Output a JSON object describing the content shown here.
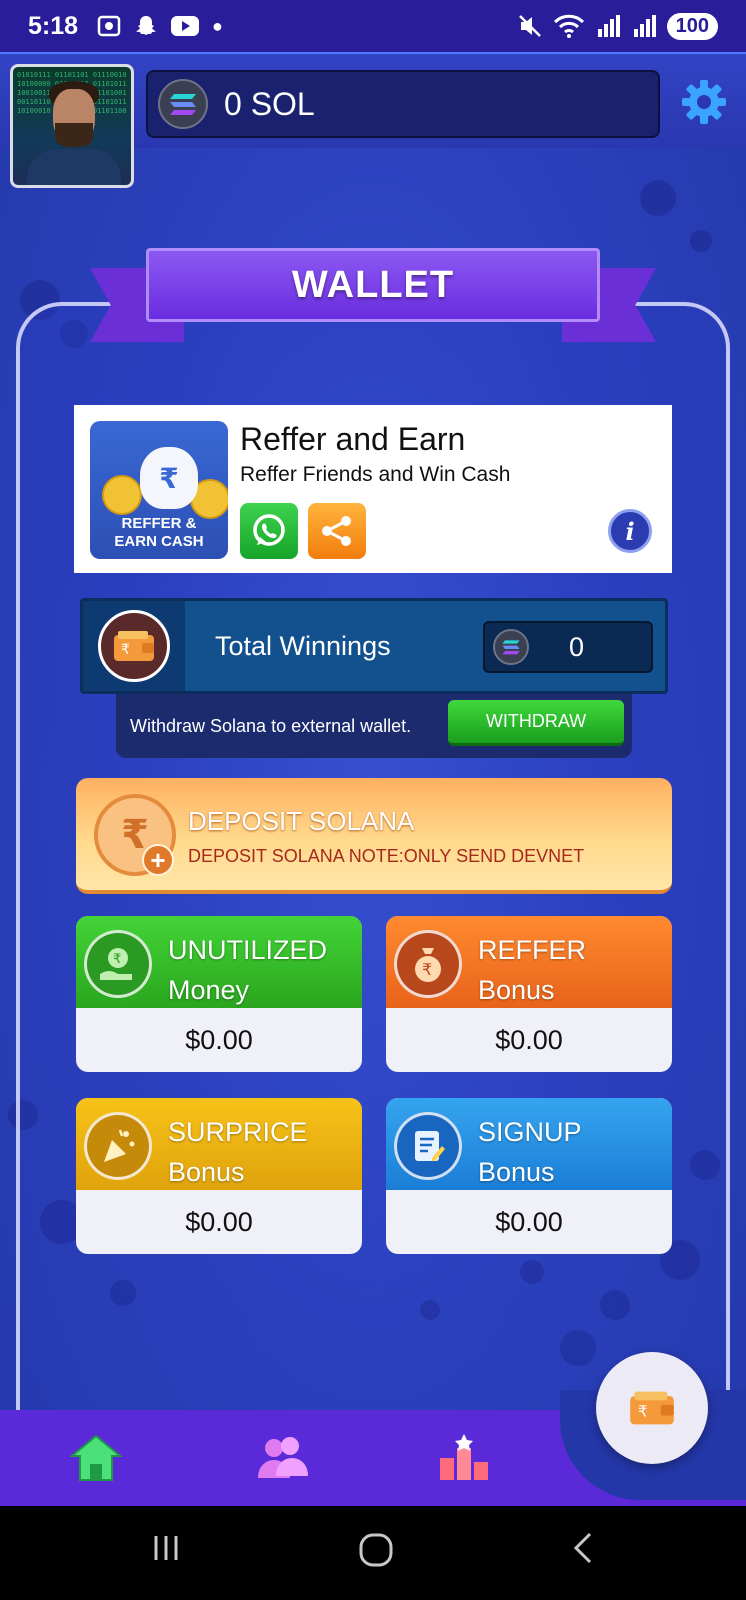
{
  "status_bar": {
    "time": "5:18",
    "battery": "100"
  },
  "header": {
    "balance": "0 SOL",
    "avatar_code": "01010111 01101101 01110010 10100000 01010010 01101011 10010011 10100110 01101001 00110110 01010111 01101011 10100010 01011001 01101100"
  },
  "wallet": {
    "title": "WALLET"
  },
  "refer": {
    "image_label_line1": "REFFER &",
    "image_label_line2": "EARN CASH",
    "title": "Reffer and Earn",
    "subtitle": "Reffer Friends and Win Cash"
  },
  "winnings": {
    "label": "Total Winnings",
    "value": "0",
    "withdraw_text": "Withdraw Solana to external wallet.",
    "withdraw_button": "WITHDRAW"
  },
  "deposit": {
    "title": "DEPOSIT SOLANA",
    "note": "DEPOSIT SOLANA NOTE:ONLY SEND DEVNET"
  },
  "tiles": [
    {
      "line1": "UNUTILIZED",
      "line2": "Money",
      "value": "$0.00"
    },
    {
      "line1": "REFFER",
      "line2": "Bonus",
      "value": "$0.00"
    },
    {
      "line1": "SURPRICE",
      "line2": "Bonus",
      "value": "$0.00"
    },
    {
      "line1": "SIGNUP",
      "line2": "Bonus",
      "value": "$0.00"
    }
  ],
  "colors": {
    "background": "#2c42bf",
    "nav": "#5a2ad8",
    "ribbon": "#7a40ea",
    "withdraw_green": "#2bbd2c"
  },
  "nav": {
    "items": [
      "home-icon",
      "friends-icon",
      "leaderboard-icon"
    ],
    "active_fab": "wallet-icon"
  }
}
